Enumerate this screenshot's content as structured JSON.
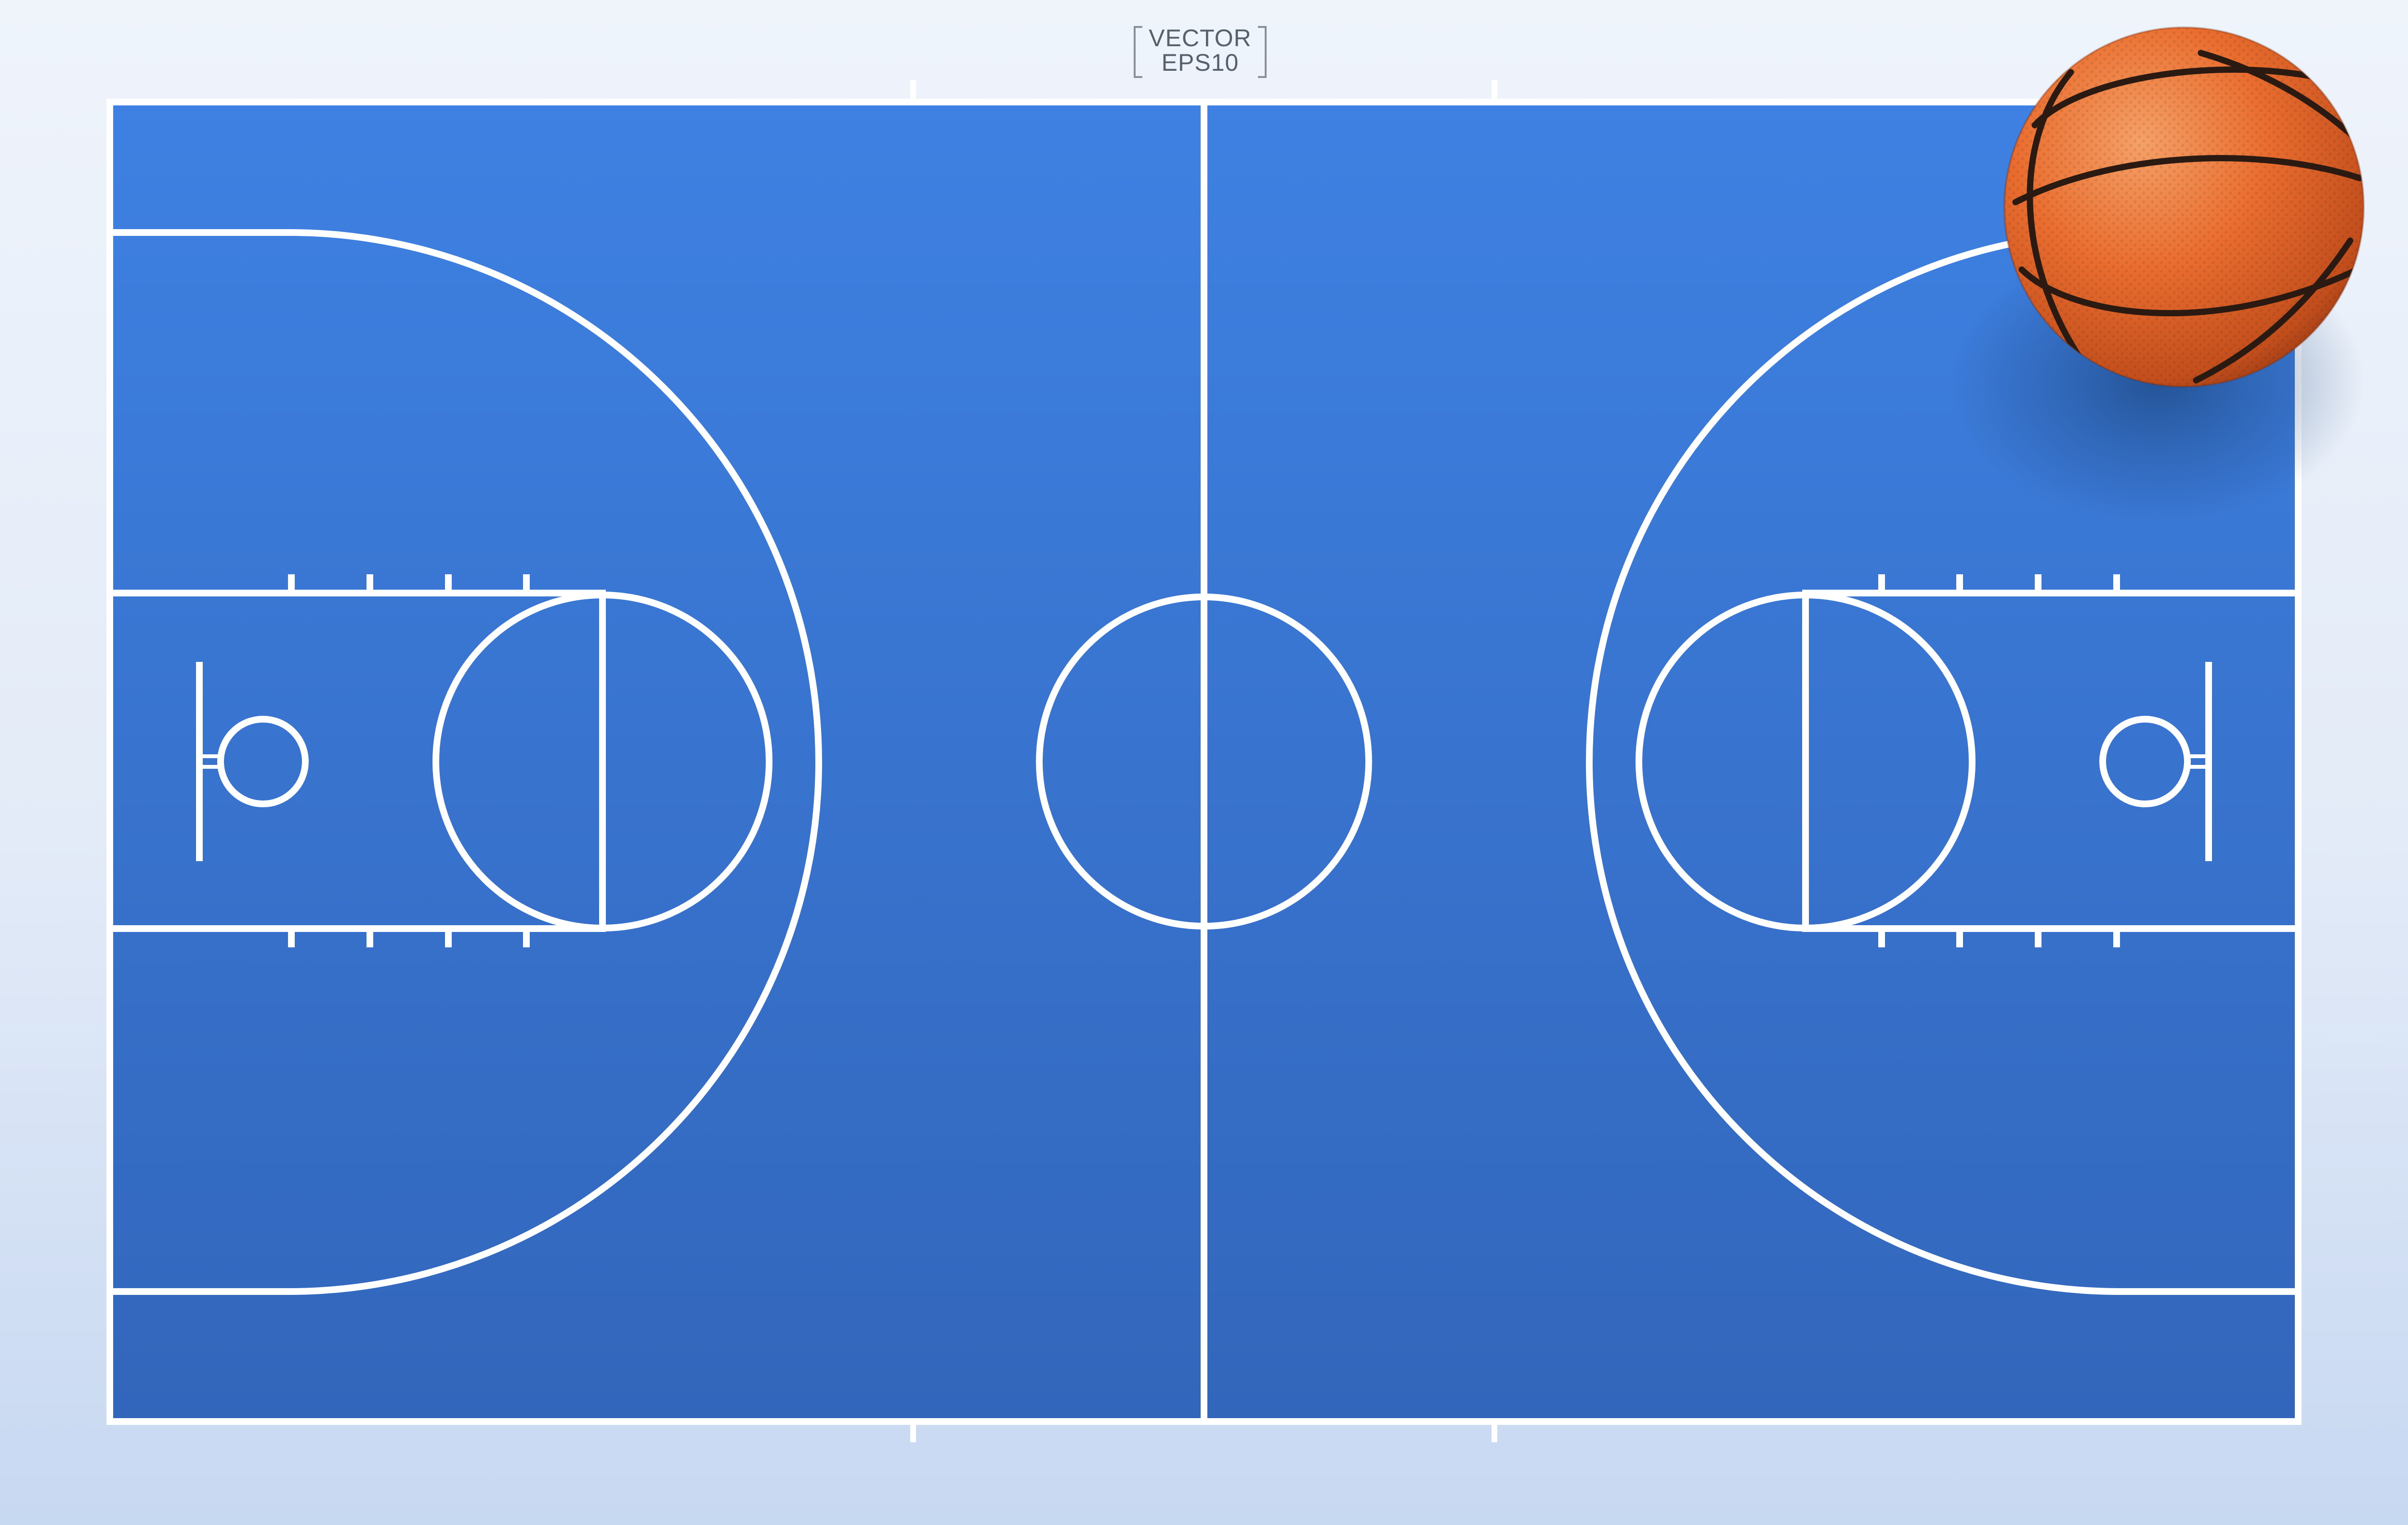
{
  "badge": {
    "line1": "VECTOR",
    "line2": "EPS10"
  },
  "colors": {
    "background_top": "#eff4fb",
    "background_bottom": "#c7d8f1",
    "court_top": "#3e81e2",
    "court_bottom": "#3266bb",
    "court_lines": "#ffffff",
    "ball": "#e96a2c",
    "ball_seams": "#2a1a12"
  },
  "icons": {
    "ball": "basketball-icon"
  }
}
